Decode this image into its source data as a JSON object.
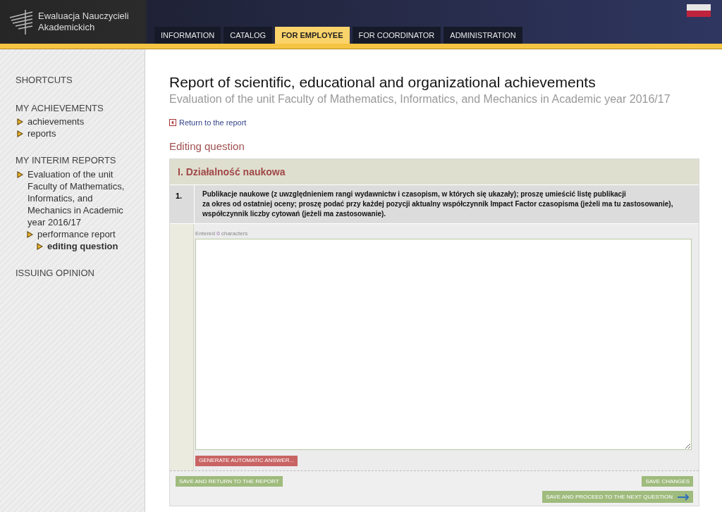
{
  "logo": {
    "line1": "Ewaluacja Nauczycieli",
    "line2": "Akademickich"
  },
  "tabs": [
    {
      "label": "INFORMATION",
      "selected": false
    },
    {
      "label": "CATALOG",
      "selected": false
    },
    {
      "label": "FOR EMPLOYEE",
      "selected": true
    },
    {
      "label": "FOR COORDINATOR",
      "selected": false
    },
    {
      "label": "ADMINISTRATION",
      "selected": false
    }
  ],
  "sidebar": {
    "sections": [
      {
        "title": "SHORTCUTS"
      },
      {
        "title": "MY ACHIEVEMENTS",
        "items": [
          {
            "label": "achievements",
            "selected": false
          },
          {
            "label": "reports",
            "selected": false
          }
        ]
      },
      {
        "title": "MY INTERIM REPORTS",
        "items": [
          {
            "label": "Evaluation of the unit Faculty of Mathematics, Informatics, and Mechanics in Academic year 2016/17",
            "selected": false,
            "children": [
              {
                "label": "performance report",
                "selected": false,
                "children": [
                  {
                    "label": "editing question",
                    "selected": true
                  }
                ]
              }
            ]
          }
        ]
      },
      {
        "title": "ISSUING OPINION"
      }
    ]
  },
  "page": {
    "title": "Report of scientific, educational and organizational achievements",
    "subtitle": "Evaluation of the unit Faculty of Mathematics, Informatics, and Mechanics in Academic year 2016/17",
    "back_link": "Return to the report",
    "heading": "Editing question"
  },
  "question": {
    "section": "I. Działalność naukowa",
    "number": "1.",
    "text": "Publikacje naukowe (z uwzględnieniem rangi wydawnictw i czasopism, w których się ukazały); proszę umieścić listę publikacji\nza okres od ostatniej oceny; proszę podać przy każdej pozycji aktualny współczynnik Impact Factor czasopisma (jeżeli ma tu zastosowanie), współczynnik liczby cytowań (jeżeli ma zastosowanie).",
    "counter_before": "Entered",
    "counter_value": "0",
    "counter_after": "characters",
    "generate_button": "GENERATE AUTOMATIC ANSWER..."
  },
  "actions": {
    "save_return": "SAVE AND RETURN TO THE REPORT",
    "save_changes": "SAVE CHANGES",
    "save_next": "SAVE AND PROCEED TO THE NEXT QUESTION"
  }
}
